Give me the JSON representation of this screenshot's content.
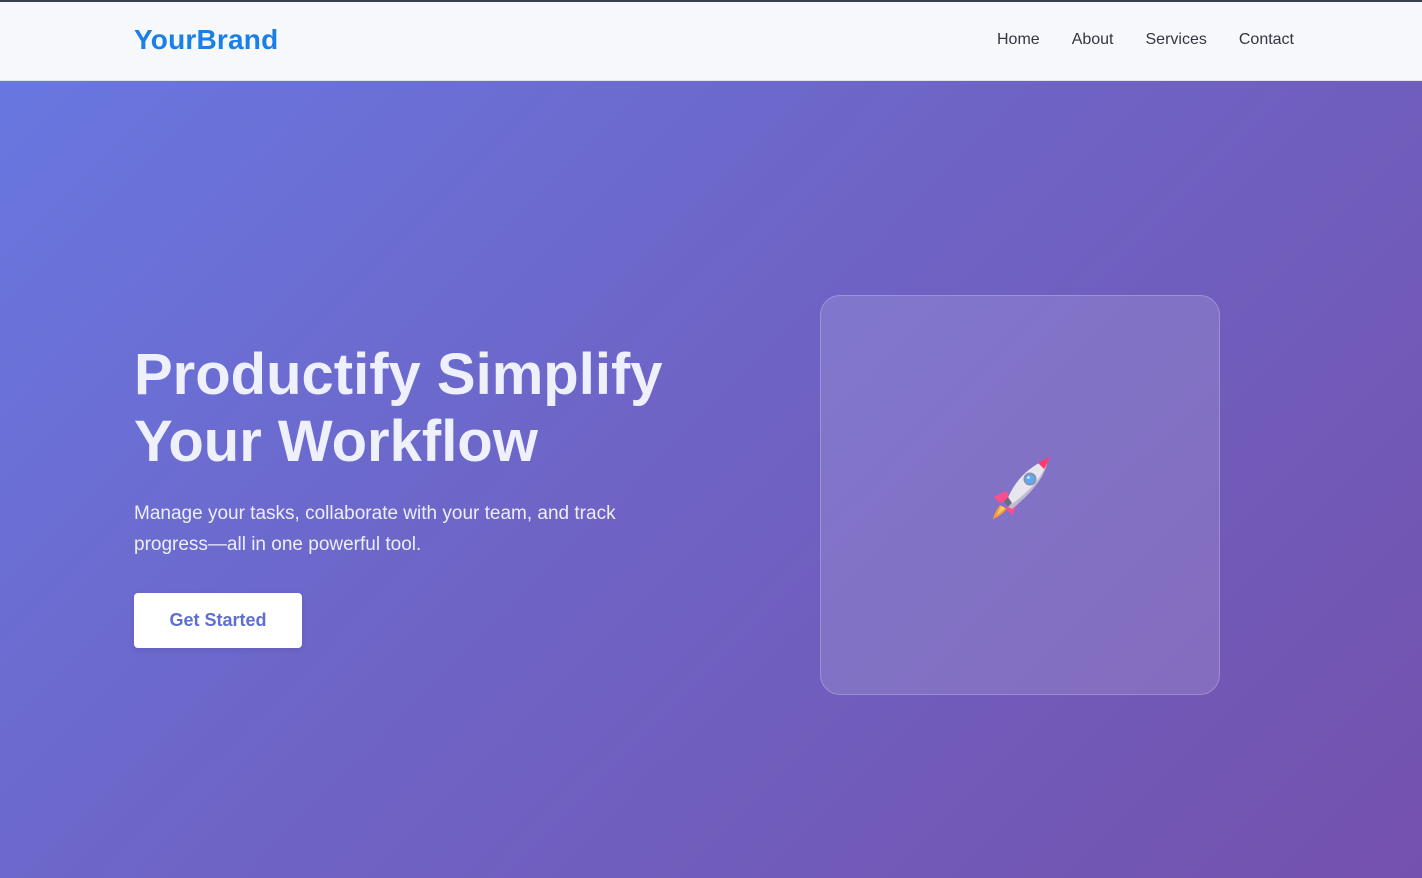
{
  "brand": {
    "name": "YourBrand"
  },
  "nav": {
    "items": [
      {
        "label": "Home"
      },
      {
        "label": "About"
      },
      {
        "label": "Services"
      },
      {
        "label": "Contact"
      }
    ]
  },
  "hero": {
    "title": "Productify Simplify Your Workflow",
    "subtitle": "Manage your tasks, collaborate with your team, and track progress—all in one powerful tool.",
    "cta_label": "Get Started",
    "illustration_icon": "rocket-icon"
  },
  "colors": {
    "brand": "#1a7fe6",
    "hero_gradient_start": "#6877e0",
    "hero_gradient_end": "#7451ad",
    "cta_text": "#5e6ed3"
  }
}
